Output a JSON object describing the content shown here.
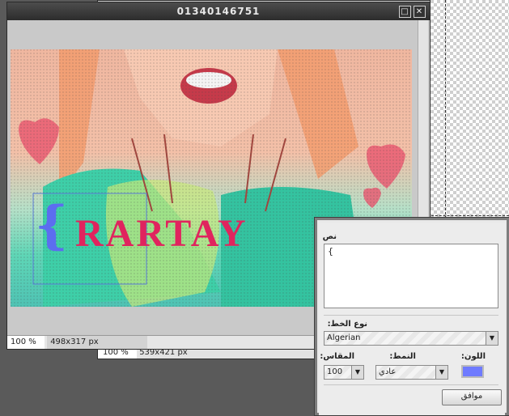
{
  "main_window": {
    "title": "01340146751",
    "zoom": "100 %",
    "dimensions": "498x317 px",
    "artwork_text": "RARTAY",
    "artwork_brace": "{"
  },
  "back_window": {
    "zoom": "100 %",
    "dimensions": "539x421 px"
  },
  "text_dialog": {
    "text_label": "نص",
    "text_value": "{",
    "font_label": "نوع الخط:",
    "font_value": "Algerian",
    "size_label": "المقاس:",
    "size_value": "100",
    "style_label": "النمط:",
    "style_value": "عادي",
    "color_label": "اللون:",
    "color_value": "#6f7bff",
    "ok_label": "موافق"
  },
  "icons": [
    "maximize-icon",
    "close-icon",
    "chevron-down-icon"
  ]
}
